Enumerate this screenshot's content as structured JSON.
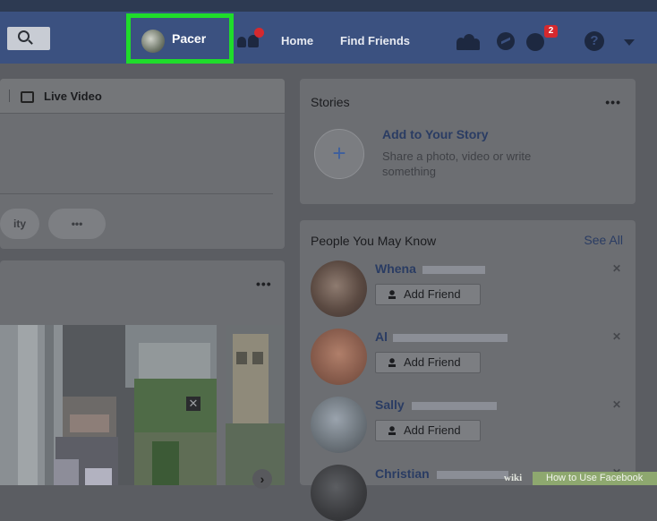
{
  "navbar": {
    "search_icon": "search-icon",
    "profile_name": "Pacer",
    "highlight_color": "#1fdc2b",
    "links": [
      "Home",
      "Find Friends"
    ],
    "notification_count": "2"
  },
  "composer": {
    "live_video_label": "Live Video",
    "pill_label": "ity",
    "more_label": "•••"
  },
  "feed": {
    "more_label": "•••",
    "close_label": "✕",
    "next_label": "›"
  },
  "stories": {
    "title": "Stories",
    "more_label": "•••",
    "add_title": "Add to Your Story",
    "add_subtitle": "Share a photo, video or write something"
  },
  "pymk": {
    "title": "People You May Know",
    "see_all": "See All",
    "add_friend_label": "Add Friend",
    "people": [
      {
        "name": "Whena"
      },
      {
        "name": "Al"
      },
      {
        "name": "Sally"
      },
      {
        "name": "Christian"
      }
    ]
  },
  "watermark": {
    "wiki": "wiki",
    "text": "How to Use Facebook"
  }
}
